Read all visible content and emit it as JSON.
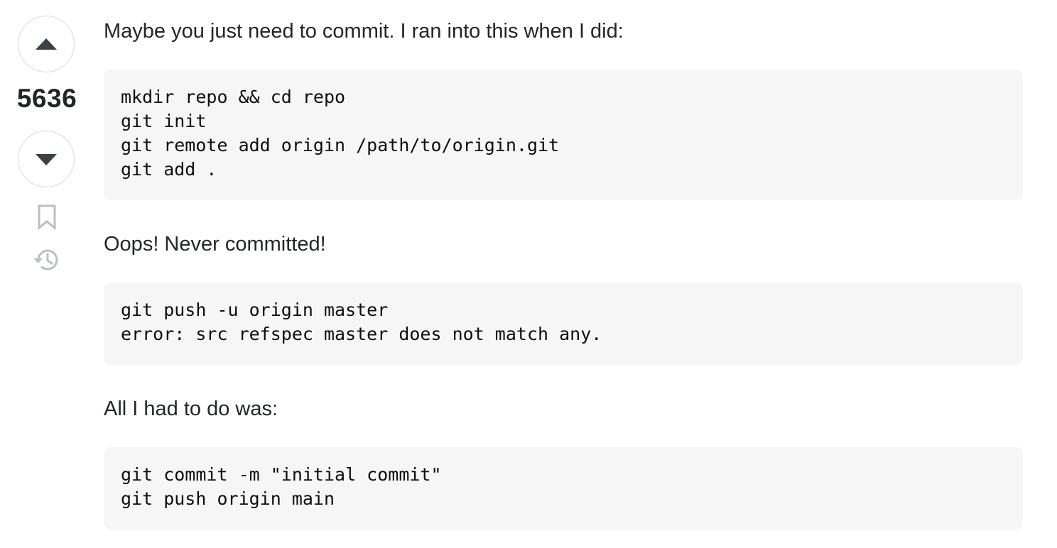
{
  "vote": {
    "score": "5636"
  },
  "answer": {
    "paragraphs": [
      "Maybe you just need to commit. I ran into this when I did:",
      "Oops! Never committed!",
      "All I had to do was:"
    ],
    "code_blocks": [
      {
        "lines": [
          "mkdir repo && cd repo",
          "git init",
          "git remote add origin /path/to/origin.git",
          "git add ."
        ]
      },
      {
        "lines": [
          "git push -u origin master",
          "error: src refspec master does not match any."
        ]
      },
      {
        "lines": [
          "git commit -m \"initial commit\"",
          "git push origin main"
        ]
      }
    ]
  },
  "icons": {
    "upvote": "upvote-arrow-icon",
    "downvote": "downvote-arrow-icon",
    "bookmark": "bookmark-icon",
    "history": "history-icon"
  },
  "colors": {
    "arrow": "#3b4045",
    "muted_icon": "#babfc4",
    "code_bg": "#f6f6f6",
    "text": "#232629"
  }
}
